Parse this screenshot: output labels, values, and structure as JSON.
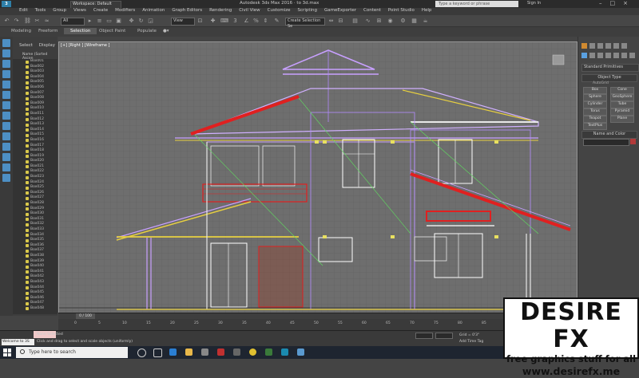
{
  "titlebar": {
    "workspace": "Workspace: Default",
    "title": "Autodesk 3ds Max 2016 · to 3d.max",
    "search_placeholder": "Type a keyword or phrase",
    "signin": "Sign In"
  },
  "menu": [
    "Edit",
    "Tools",
    "Group",
    "Views",
    "Create",
    "Modifiers",
    "Animation",
    "Graph Editors",
    "Rendering",
    "Civil View",
    "Customize",
    "Scripting",
    "GameExporter",
    "Content",
    "Point Studio",
    "Help"
  ],
  "toolbar": {
    "filter": "All",
    "view": "View",
    "selection_set": "Create Selection Se"
  },
  "ribbon": {
    "tabs": [
      "Modeling",
      "Freeform",
      "Selection",
      "Object Paint",
      "Populate"
    ],
    "active": "Selection"
  },
  "scene_explorer": {
    "tabs": [
      "Select",
      "Display"
    ],
    "header": "Name (Sorted Ascen",
    "items": [
      "Box001",
      "Box002",
      "Box003",
      "Box004",
      "Box005",
      "Box006",
      "Box007",
      "Box008",
      "Box009",
      "Box010",
      "Box011",
      "Box012",
      "Box013",
      "Box014",
      "Box015",
      "Box016",
      "Box017",
      "Box018",
      "Box019",
      "Box020",
      "Box021",
      "Box022",
      "Box023",
      "Box024",
      "Box025",
      "Box026",
      "Box027",
      "Box028",
      "Box029",
      "Box030",
      "Box031",
      "Box032",
      "Box033",
      "Box034",
      "Box035",
      "Box036",
      "Box037",
      "Box038",
      "Box039",
      "Box040",
      "Box041",
      "Box042",
      "Box043",
      "Box044",
      "Box045",
      "Box046",
      "Box047",
      "Box048"
    ]
  },
  "viewport": {
    "label": "[+] [Right ] [Wireframe ]"
  },
  "command_panel": {
    "dropdown": "Standard Primitives",
    "object_type": "Object Type",
    "autogrid": "AutoGrid",
    "buttons": [
      "Box",
      "Cone",
      "Sphere",
      "GeoSphere",
      "Cylinder",
      "Tube",
      "Torus",
      "Pyramid",
      "Teapot",
      "Plane",
      "TextPlus"
    ],
    "name_color": "Name and Color"
  },
  "timeline": {
    "frame": "0 / 100",
    "ticks": [
      "0",
      "5",
      "10",
      "15",
      "20",
      "25",
      "30",
      "35",
      "40",
      "45",
      "50",
      "55",
      "60",
      "65",
      "70",
      "75",
      "80",
      "85",
      "90",
      "95",
      "100"
    ]
  },
  "status": {
    "welcome": "Welcome to 3S",
    "selection": "None Selected",
    "prompt": "Click and drag to select and scale objects (uniformly)",
    "grid": "Grid = 0'3\"",
    "add_time_tag": "Add Time Tag"
  },
  "taskbar": {
    "search": "Type here to search"
  },
  "watermark": {
    "brand": "DESIRE FX",
    "line2": "free graphics stuff for all",
    "line3": "www.desirefx.me"
  },
  "colors": {
    "viewport_bg": "#6e6e6e",
    "selected_red": "#e02020",
    "wire_yellow": "#e8d040",
    "wire_purple": "#b48cff",
    "wire_green": "#5fe05f"
  }
}
